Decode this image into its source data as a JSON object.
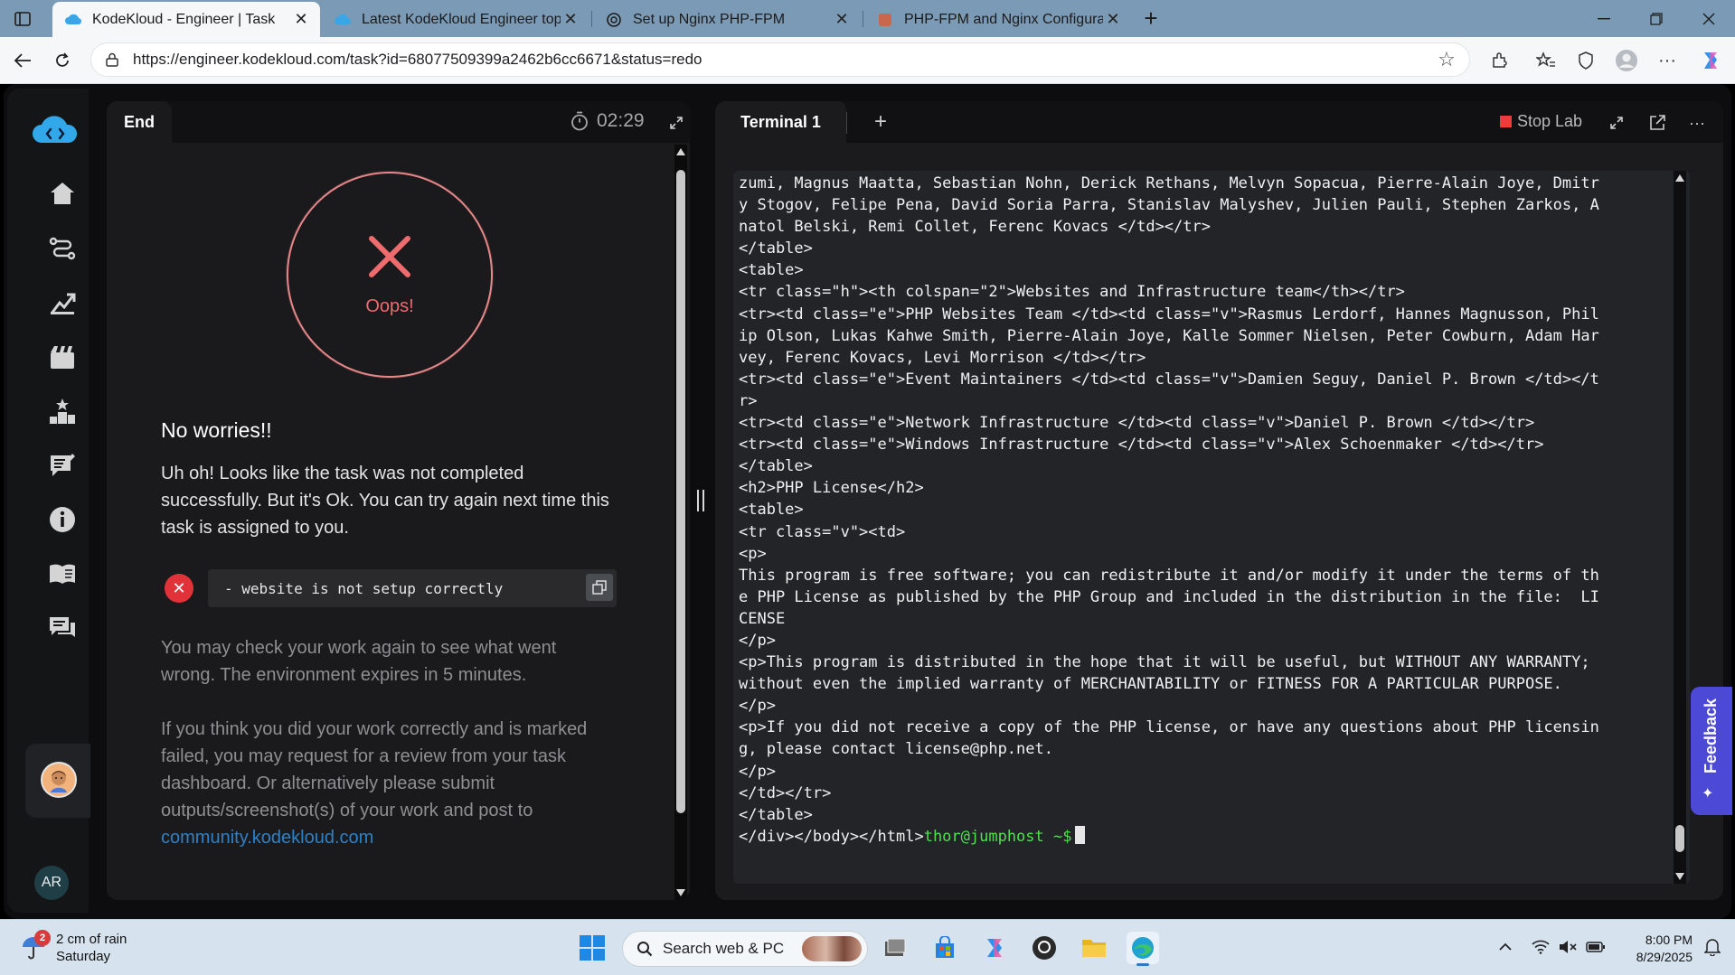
{
  "browser": {
    "tabs": [
      {
        "title": "KodeKloud - Engineer | Task",
        "active": true
      },
      {
        "title": "Latest KodeKloud Engineer topics",
        "active": false
      },
      {
        "title": "Set up Nginx PHP-FPM",
        "active": false
      },
      {
        "title": "PHP-FPM and Nginx Configuratio",
        "active": false
      }
    ],
    "url": "https://engineer.kodekloud.com/task?id=68077509399a2462b6cc6671&status=redo"
  },
  "left_panel": {
    "tab_label": "End",
    "timer": "02:29",
    "result_label": "Oops!",
    "title": "No worries!!",
    "message": "Uh oh! Looks like the task was not completed successfully. But it's Ok. You can try again next time this task is assigned to you.",
    "error_text": "- website is not setup correctly",
    "check_text": "You may check your work again to see what went wrong. The environment expires in 5 minutes.",
    "review_text": "If you think you did your work correctly and is marked failed, you may request for a review from your task dashboard. Or alternatively please submit outputs/screenshot(s) of your work and post to",
    "community_link": "community.kodekloud.com"
  },
  "sidebar": {
    "initials": "AR",
    "items": [
      "home",
      "roadmap",
      "progress",
      "courses",
      "leaderboard",
      "tasks",
      "info",
      "docs",
      "messages"
    ]
  },
  "terminal": {
    "tab_label": "Terminal 1",
    "stop_label": "Stop Lab",
    "lines": [
      "zumi, Magnus Maatta, Sebastian Nohn, Derick Rethans, Melvyn Sopacua, Pierre-Alain Joye, Dmitr",
      "y Stogov, Felipe Pena, David Soria Parra, Stanislav Malyshev, Julien Pauli, Stephen Zarkos, A",
      "natol Belski, Remi Collet, Ferenc Kovacs </td></tr>",
      "</table>",
      "<table>",
      "<tr class=\"h\"><th colspan=\"2\">Websites and Infrastructure team</th></tr>",
      "<tr><td class=\"e\">PHP Websites Team </td><td class=\"v\">Rasmus Lerdorf, Hannes Magnusson, Phil",
      "ip Olson, Lukas Kahwe Smith, Pierre-Alain Joye, Kalle Sommer Nielsen, Peter Cowburn, Adam Har",
      "vey, Ferenc Kovacs, Levi Morrison </td></tr>",
      "<tr><td class=\"e\">Event Maintainers </td><td class=\"v\">Damien Seguy, Daniel P. Brown </td></t",
      "r>",
      "<tr><td class=\"e\">Network Infrastructure </td><td class=\"v\">Daniel P. Brown </td></tr>",
      "<tr><td class=\"e\">Windows Infrastructure </td><td class=\"v\">Alex Schoenmaker </td></tr>",
      "</table>",
      "<h2>PHP License</h2>",
      "<table>",
      "<tr class=\"v\"><td>",
      "<p>",
      "This program is free software; you can redistribute it and/or modify it under the terms of th",
      "e PHP License as published by the PHP Group and included in the distribution in the file:  LI",
      "CENSE",
      "</p>",
      "<p>This program is distributed in the hope that it will be useful, but WITHOUT ANY WARRANTY;",
      "without even the implied warranty of MERCHANTABILITY or FITNESS FOR A PARTICULAR PURPOSE.",
      "</p>",
      "<p>If you did not receive a copy of the PHP license, or have any questions about PHP licensin",
      "g, please contact license@php.net.",
      "</p>",
      "</td></tr>",
      "</table>"
    ],
    "last_line_output": "</div></body></html>",
    "prompt": "thor@jumphost ~$"
  },
  "feedback_label": "Feedback",
  "taskbar": {
    "weather_badge": "2",
    "weather_line1": "2 cm of rain",
    "weather_line2": "Saturday",
    "search_placeholder": "Search web & PC",
    "time": "8:00 PM",
    "date": "8/29/2025"
  },
  "colors": {
    "accent_red": "#ee6b6e",
    "prompt_green": "#4ee04e",
    "link_blue": "#2f80c4",
    "feedback_purple": "#4c49d6"
  }
}
